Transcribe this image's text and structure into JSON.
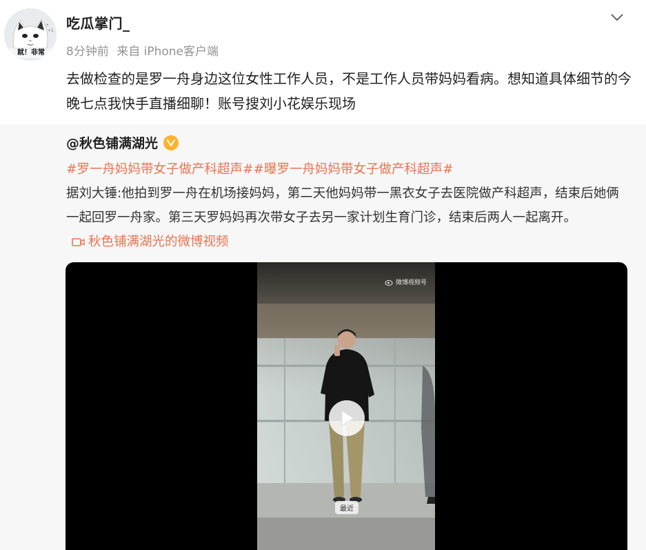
{
  "header": {
    "username": "吃瓜掌门_",
    "time": "8分钟前",
    "source": "来自 iPhone客户端",
    "avatar_caption": "就！非常"
  },
  "post": {
    "text": "去做检查的是罗一舟身边这位女性工作人员，不是工作人员带妈妈看病。想知道具体细节的今晚七点我快手直播细聊！账号搜刘小花娱乐现场"
  },
  "repost": {
    "author": "@秋色铺满湖光",
    "topics": [
      "#罗一舟妈妈带女子做产科超声#",
      "#曝罗一舟妈妈带女子做产科超声#"
    ],
    "body": "据刘大锤:他拍到罗一舟在机场接妈妈，第二天他妈妈带一黑衣女子去医院做产科超声，结束后她俩一起回罗一舟家。第三天罗妈妈再次带女子去另一家计划生育门诊，结束后两人一起离开。",
    "video_link": "秋色铺满湖光的微博视频"
  },
  "video": {
    "watermark": "微博视频号",
    "recent_label": "最近"
  },
  "colors": {
    "link": "#eb7350",
    "meta": "#939393",
    "repost_bg": "#f7f7f7",
    "badge": "#ffb22e"
  },
  "icons": [
    "chevron-down-icon",
    "verified-badge-icon",
    "video-camera-icon",
    "play-icon",
    "weibo-logo-icon"
  ]
}
